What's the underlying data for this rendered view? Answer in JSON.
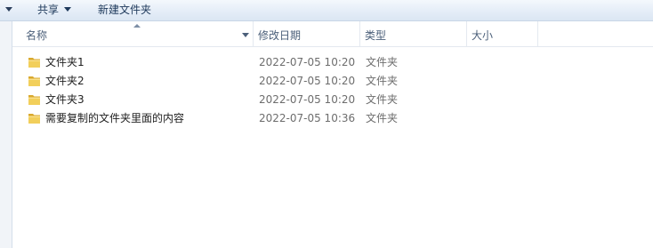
{
  "toolbar": {
    "share_label": "共享",
    "new_folder_label": "新建文件夹"
  },
  "columns": {
    "name": "名称",
    "date_modified": "修改日期",
    "type": "类型",
    "size": "大小"
  },
  "files": [
    {
      "name": "文件夹1",
      "date": "2022-07-05 10:20",
      "type": "文件夹",
      "icon": "folder-icon"
    },
    {
      "name": "文件夹2",
      "date": "2022-07-05 10:20",
      "type": "文件夹",
      "icon": "folder-icon"
    },
    {
      "name": "文件夹3",
      "date": "2022-07-05 10:20",
      "type": "文件夹",
      "icon": "folder-icon"
    },
    {
      "name": "需要复制的文件夹里面的内容",
      "date": "2022-07-05 10:36",
      "type": "文件夹",
      "icon": "folder-icon"
    }
  ],
  "colors": {
    "toolbar_text": "#1e395b",
    "header_text": "#4c607a",
    "folder_yellow": "#e8c14f"
  }
}
